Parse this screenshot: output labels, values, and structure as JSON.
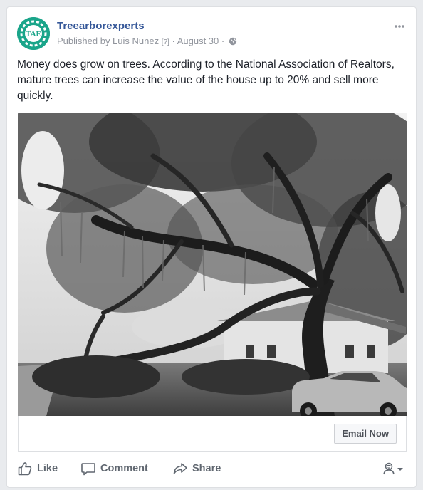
{
  "post": {
    "page_name": "Treearborexperts",
    "avatar_text": "TAE",
    "published_by": "Published by Luis Nunez",
    "help_marker": "[?]",
    "separator": "·",
    "date": "August 30",
    "privacy_icon": "globe-icon",
    "more_icon": "ellipsis-icon",
    "text": "Money does grow on trees. According to the National Association of Realtors, mature trees can increase the value of the house up to 20% and sell more quickly.",
    "image": {
      "description_icon": "photo-oak-tree-house-car",
      "style": "black-and-white photo"
    },
    "cta": {
      "label": "Email Now"
    }
  },
  "actions": {
    "like": "Like",
    "comment": "Comment",
    "share": "Share",
    "like_icon": "thumbs-up-icon",
    "comment_icon": "speech-bubble-icon",
    "share_icon": "share-arrow-icon",
    "audience_icon": "user-selector-icon"
  },
  "colors": {
    "brand_link": "#365899",
    "muted": "#90949c",
    "action_text": "#606770",
    "avatar_bg": "#1aa58a",
    "page_bg": "#e9ebee"
  }
}
